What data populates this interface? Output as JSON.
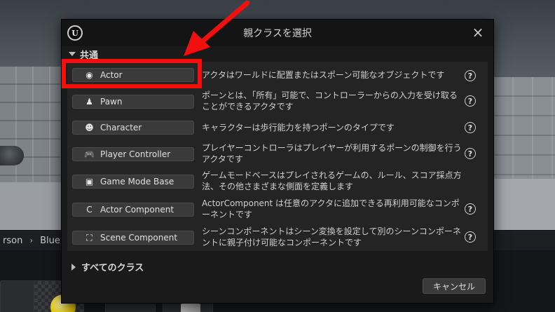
{
  "dialog": {
    "title": "親クラスを選択",
    "logo_text": "U",
    "close_glyph": "×",
    "section_label": "共通",
    "all_classes_label": "すべてのクラス",
    "cancel_label": "キャンセル"
  },
  "classes": [
    {
      "name": "Actor",
      "icon": "actor-sphere-icon",
      "glyph": "◉",
      "description": "アクタはワールドに配置またはスポーン可能なオブジェクトです"
    },
    {
      "name": "Pawn",
      "icon": "pawn-figure-icon",
      "glyph": "♟",
      "description": "ポーンとは、「所有」可能で、コントローラーからの入力を受け取ることができるアクタです"
    },
    {
      "name": "Character",
      "icon": "character-bust-icon",
      "glyph": "☻",
      "description": "キャラクターは歩行能力を持つポーンのタイプです"
    },
    {
      "name": "Player Controller",
      "icon": "gamepad-icon",
      "glyph": "🎮",
      "description": "プレイヤーコントローラはプレイヤーが利用するポーンの制御を行うアクタです"
    },
    {
      "name": "Game Mode Base",
      "icon": "game-mode-image-icon",
      "glyph": "▣",
      "description": "ゲームモードベースはプレイされるゲームの、ルール、スコア採点方法、その他さまざまな側面を定義します"
    },
    {
      "name": "Actor Component",
      "icon": "actor-component-icon",
      "glyph": "C",
      "description": "ActorComponent は任意のアクタに追加できる再利用可能なコンポーネントです"
    },
    {
      "name": "Scene Component",
      "icon": "scene-component-icon",
      "glyph": "⛶",
      "description": "シーンコンポーネントはシーン変換を設定して別のシーンコンポーネントに親子付け可能なコンポーネントです"
    }
  ],
  "help_glyph": "?",
  "background": {
    "breadcrumb": [
      "rson",
      "Bluep"
    ],
    "breadcrumb_sep": "›"
  },
  "colors": {
    "annotation_red": "#f10f0f",
    "dialog_bg": "#1a1a1a",
    "list_bg": "#242424",
    "button_bg": "#3a3a3a"
  }
}
